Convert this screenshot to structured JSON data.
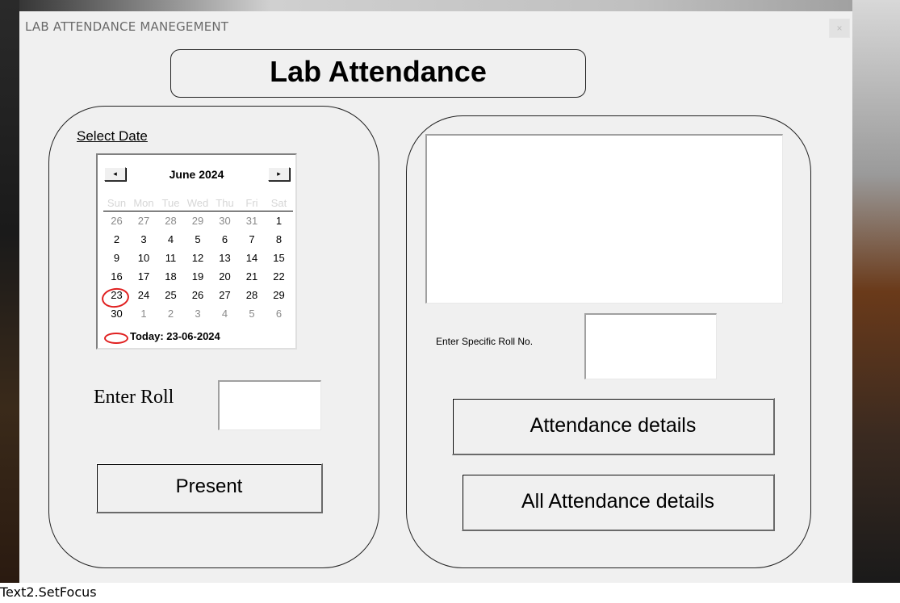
{
  "window": {
    "title": "LAB ATTENDANCE MANEGEMENT",
    "close_glyph": "×"
  },
  "heading": "Lab Attendance",
  "left_panel": {
    "select_date_label": "Select Date",
    "calendar": {
      "prev_glyph": "◂",
      "next_glyph": "▸",
      "month_label": "June 2024",
      "weekdays": [
        "Sun",
        "Mon",
        "Tue",
        "Wed",
        "Thu",
        "Fri",
        "Sat"
      ],
      "weeks": [
        [
          "26",
          "27",
          "28",
          "29",
          "30",
          "31",
          "1"
        ],
        [
          "2",
          "3",
          "4",
          "5",
          "6",
          "7",
          "8"
        ],
        [
          "9",
          "10",
          "11",
          "12",
          "13",
          "14",
          "15"
        ],
        [
          "16",
          "17",
          "18",
          "19",
          "20",
          "21",
          "22"
        ],
        [
          "23",
          "24",
          "25",
          "26",
          "27",
          "28",
          "29"
        ],
        [
          "30",
          "1",
          "2",
          "3",
          "4",
          "5",
          "6"
        ]
      ],
      "selected_day": "23",
      "today_label": "Today: 23-06-2024",
      "annotation_color": "#e02020"
    },
    "enter_roll_label": "Enter Roll",
    "enter_roll_value": "",
    "present_button": "Present"
  },
  "right_panel": {
    "listbox_items": [],
    "specific_roll_label": "Enter Specific Roll No.",
    "specific_roll_value": "",
    "attendance_details_button": "Attendance details",
    "all_attendance_details_button": "All Attendance details"
  },
  "status_text": "Text2.SetFocus"
}
